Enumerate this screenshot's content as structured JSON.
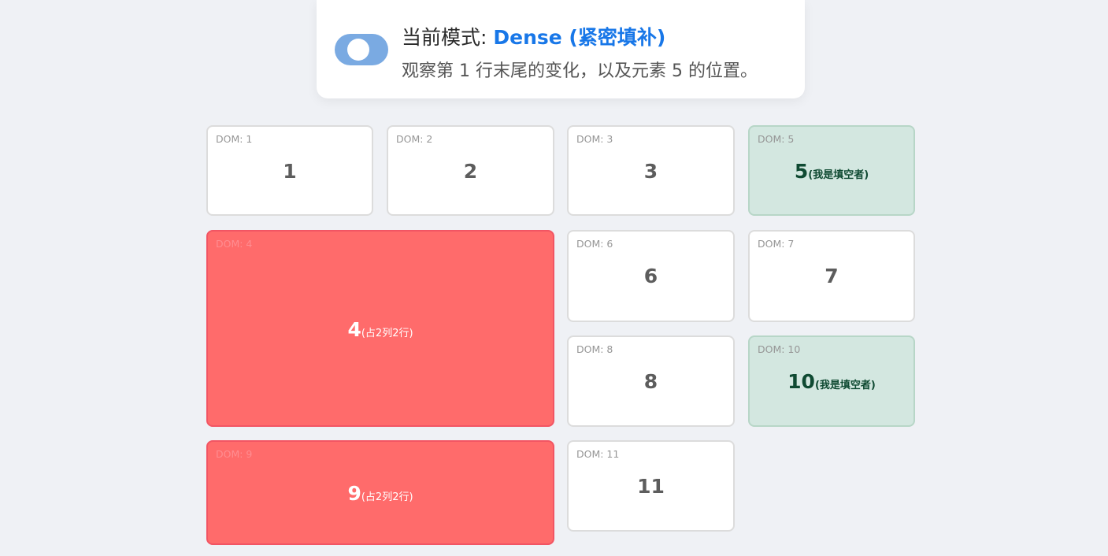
{
  "header": {
    "toggle_on": true,
    "mode_prefix": "当前模式: ",
    "mode_value": "Dense (紧密填补)",
    "hint": "观察第 1 行末尾的变化，以及元素 5 的位置。"
  },
  "colors": {
    "accent": "#1877e8",
    "toggle": "#7aaae2",
    "span_item": "#ff6b6b",
    "filler_item": "#d3e7e0",
    "background": "#eff1f5"
  },
  "grid": {
    "items": [
      {
        "dom": "DOM: 1",
        "number": "1",
        "note": ""
      },
      {
        "dom": "DOM: 2",
        "number": "2",
        "note": ""
      },
      {
        "dom": "DOM: 3",
        "number": "3",
        "note": ""
      },
      {
        "dom": "DOM: 5",
        "number": "5",
        "note": "(我是填空者)"
      },
      {
        "dom": "DOM: 4",
        "number": "4",
        "note": "(占2列2行)"
      },
      {
        "dom": "DOM: 6",
        "number": "6",
        "note": ""
      },
      {
        "dom": "DOM: 7",
        "number": "7",
        "note": ""
      },
      {
        "dom": "DOM: 8",
        "number": "8",
        "note": ""
      },
      {
        "dom": "DOM: 10",
        "number": "10",
        "note": "(我是填空者)"
      },
      {
        "dom": "DOM: 9",
        "number": "9",
        "note": "(占2列2行)"
      },
      {
        "dom": "DOM: 11",
        "number": "11",
        "note": ""
      }
    ]
  }
}
